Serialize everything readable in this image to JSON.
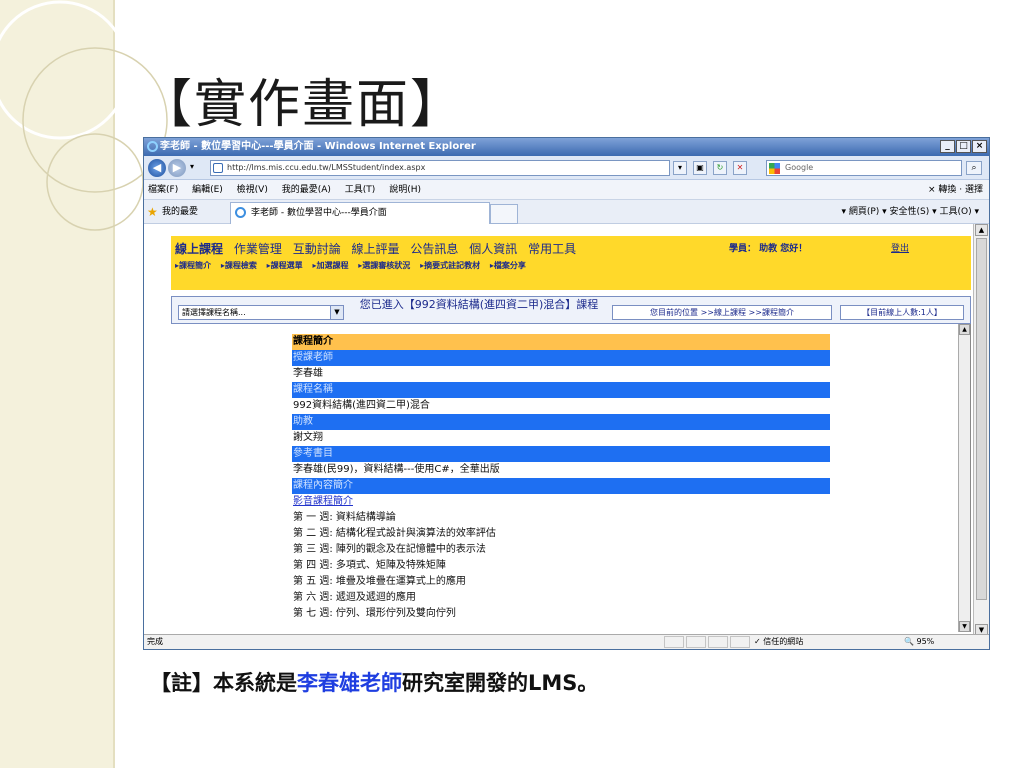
{
  "slide": {
    "title": "【實作畫面】",
    "note_prefix": "【註】本系統是",
    "note_highlight": "李春雄老師",
    "note_suffix": "研究室開發的LMS。",
    "highlight_color": "#1f3ee0"
  },
  "browser": {
    "window_title": "李老師 - 數位學習中心---學員介面 - Windows Internet Explorer",
    "window_buttons": [
      "_",
      "□",
      "×"
    ],
    "url": "http://lms.mis.ccu.edu.tw/LMSStudent/index.aspx",
    "search_placeholder": "Google",
    "menu": [
      "檔案(F)",
      "編輯(E)",
      "檢視(V)",
      "我的最愛(A)",
      "工具(T)",
      "說明(H)"
    ],
    "menu_right": "×  轉換  ·  選擇",
    "favorites_label": "我的最愛",
    "tab_title": "李老師 - 數位學習中心---學員介面",
    "command_right": "▾  網頁(P) ▾  安全性(S) ▾  工具(O) ▾",
    "status_left": "完成",
    "status_zone": "✓ 信任的網站",
    "status_zoom": "🔍 95%"
  },
  "lms": {
    "main_nav": [
      "線上課程",
      "作業管理",
      "互動討論",
      "線上評量",
      "公告訊息",
      "個人資訊",
      "常用工具"
    ],
    "student_label": "學員：    助教 您好！",
    "logout_label": "登出",
    "sub_nav": [
      "▸課程簡介",
      "▸課程檢索",
      "▸課程選單",
      "▸加選課程",
      "▸選課審核狀況",
      "▸摘要式註記教材",
      "▸檔案分享"
    ],
    "course_select_placeholder": "請選擇課程名稱...",
    "entered_text": "您已進入【992資料結構(進四資二甲)混合】課程",
    "location_text": "您目前的位置 >>線上課程 >>課程簡介",
    "online_text": "【目前線上人數:1人】"
  },
  "course": {
    "heading": "課程簡介",
    "teacher_label": "授課老師",
    "teacher_value": "李春雄",
    "name_label": "課程名稱",
    "name_value": "992資料結構(進四資二甲)混合",
    "ta_label": "助教",
    "ta_value": "謝文翔",
    "book_label": "參考書目",
    "book_value": "李春雄(民99)，資料結構---使用C#，全華出版",
    "content_label": "課程內容簡介",
    "link_text": "影音課程簡介",
    "weeks": [
      "第 一 週: 資料結構導論",
      "第 二 週: 結構化程式設計與演算法的效率評估",
      "第 三 週: 陣列的觀念及在記憶體中的表示法",
      "第 四 週: 多項式、矩陣及特殊矩陣",
      "第 五 週: 堆疊及堆疊在運算式上的應用",
      "第 六 週: 遞迴及遞迴的應用",
      "第 七 週: 佇列、環形佇列及雙向佇列"
    ]
  },
  "colors": {
    "nav_bg": "#ffd92a",
    "heading_bg": "#ffc14d",
    "section_bg": "#1e6ff2"
  }
}
